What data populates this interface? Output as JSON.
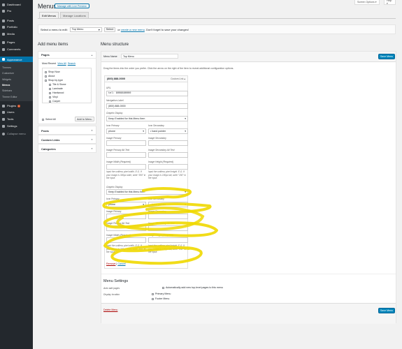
{
  "admin_menu": {
    "items": [
      {
        "label": "Dashboard",
        "icon": "dashboard-icon"
      },
      {
        "label": "Pro",
        "icon": "pro-icon"
      },
      {
        "label": "Posts",
        "icon": "pin-icon"
      },
      {
        "label": "Portfolio",
        "icon": "portfolio-icon"
      },
      {
        "label": "Media",
        "icon": "media-icon"
      },
      {
        "label": "Pages",
        "icon": "page-icon"
      },
      {
        "label": "Comments",
        "icon": "comment-icon"
      },
      {
        "label": "Appearance",
        "icon": "paintbrush-icon"
      },
      {
        "label": "Plugins",
        "icon": "plugin-icon",
        "badge": "1"
      },
      {
        "label": "Users",
        "icon": "users-icon"
      },
      {
        "label": "Tools",
        "icon": "wrench-icon"
      },
      {
        "label": "Settings",
        "icon": "settings-icon"
      },
      {
        "label": "Collapse menu",
        "icon": "collapse-icon"
      }
    ],
    "appearance_sub": [
      "Themes",
      "Customize",
      "Widgets",
      "Menus",
      "Sidebars",
      "Theme Editor"
    ]
  },
  "screen_options": "Screen Options ▾",
  "help": "Help ▾",
  "page": {
    "title": "Menus",
    "live_preview": "Manage with Live Preview",
    "tabs": [
      "Edit Menus",
      "Manage Locations"
    ]
  },
  "select_bar": {
    "label": "Select a menu to edit:",
    "selected": "Top Menu",
    "select_button": "Select",
    "or": "or",
    "create_link": "create a new menu",
    "hint": ". Don't forget to save your changes!"
  },
  "add_items": {
    "heading": "Add menu items",
    "pages_title": "Pages",
    "subtabs": [
      "Most Recent",
      "View All",
      "Search"
    ],
    "pages": [
      "Shop Now",
      "About",
      "Shop by type",
      "Tile & Stone",
      "Laminate",
      "Hardwood",
      "Vinyl",
      "Carpet"
    ],
    "select_all": "Select All",
    "add_button": "Add to Menu",
    "sections": [
      "Posts",
      "Custom Links",
      "Categories"
    ]
  },
  "structure": {
    "heading": "Menu structure",
    "name_label": "Menu Name",
    "name_value": "Top Menu",
    "save_label": "Save Menu",
    "instructions": "Drag the items into the order you prefer. Click the arrow on the right of the item to reveal additional configuration options.",
    "item_title": "(800) 888-0000",
    "item_type": "Custom Link",
    "url_label": "URL",
    "url_value": "tel: 8008880000",
    "nav_label_label": "Navigation Label",
    "nav_label_value": "(800) 888-0000",
    "graphic_display_label": "Graphic Display",
    "graphic_display_value": "Keep Enabled for this Menu Item",
    "icon_primary_label": "Icon Primary",
    "icon_primary_value": "phone",
    "icon_secondary_label": "Icon Secondary",
    "icon_secondary_value": "• hand pointer",
    "image_primary_label": "Image Primary",
    "image_secondary_label": "Image Secondary",
    "image_primary_alt_label": "Image Primary Alt Text",
    "image_secondary_alt_label": "Image Secondary Alt Text",
    "image_width_label": "Image Width (Required)",
    "image_height_label": "Image Height (Required)",
    "width_desc": "Input the unitless pixel width. E.G. If your image is 300px wide, write \"300\" in the input.",
    "height_desc": "Input the unitless pixel height. E.G. If your image is 150px tall, write \"150\" in the input.",
    "remove": "Remove",
    "cancel": "Cancel",
    "separator": "|"
  },
  "settings": {
    "heading": "Menu Settings",
    "auto_add_label": "Auto add pages",
    "auto_add_text": "Automatically add new top-level pages to this menu",
    "display_label": "Display location",
    "locations": [
      "Primary Menu",
      "Footer Menu"
    ],
    "delete": "Delete Menu",
    "save_label": "Save Menu"
  },
  "colors": {
    "accent": "#0073aa",
    "sidebar": "#23282d",
    "annotation": "#f0d800"
  }
}
